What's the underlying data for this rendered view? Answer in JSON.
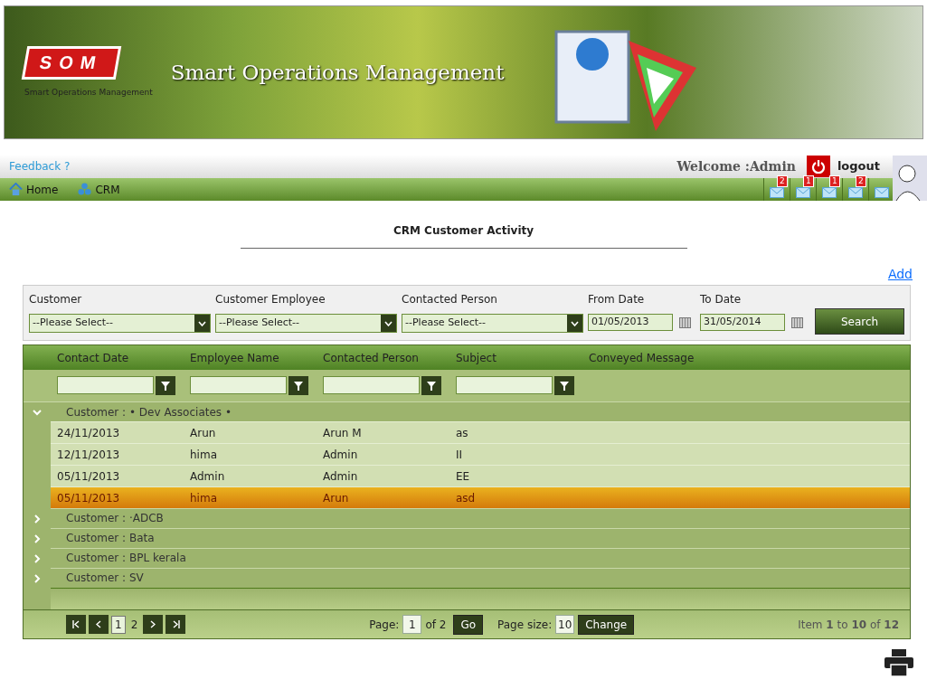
{
  "header": {
    "logo_text": "SOM",
    "logo_caption": "Smart Operations Management",
    "title": "Smart Operations Management"
  },
  "topbar": {
    "feedback": "Feedback",
    "feedback_mark": "?",
    "welcome": "Welcome :Admin",
    "logout": "logout"
  },
  "nav": [
    {
      "label": "Home"
    },
    {
      "label": "CRM"
    }
  ],
  "mail_icons": [
    {
      "kind": "badged",
      "count": "2"
    },
    {
      "kind": "badged",
      "count": "1"
    },
    {
      "kind": "badged",
      "count": "1"
    },
    {
      "kind": "badged",
      "count": "2"
    },
    {
      "kind": "plain"
    }
  ],
  "page_title": "CRM Customer Activity",
  "add_link": "Add",
  "filters": [
    {
      "kind": "select",
      "label": "Customer",
      "value": "--Please Select--"
    },
    {
      "kind": "select",
      "label": "Customer Employee",
      "value": "--Please Select--"
    },
    {
      "kind": "select",
      "label": "Contacted Person",
      "value": "--Please Select--"
    },
    {
      "kind": "date",
      "label": "From Date",
      "value": "01/05/2013"
    },
    {
      "kind": "date",
      "label": "To Date",
      "value": "31/05/2014"
    }
  ],
  "search_button": "Search",
  "grid": {
    "columns": [
      {
        "label": "Contact Date",
        "filter": true
      },
      {
        "label": "Employee Name",
        "filter": true
      },
      {
        "label": "Contacted Person",
        "filter": true
      },
      {
        "label": "Subject",
        "filter": true
      },
      {
        "label": "Conveyed Message",
        "filter": false
      }
    ],
    "groups": [
      {
        "label": "Customer : • Dev Associates •",
        "expanded": true,
        "rows": [
          {
            "cells": [
              "24/11/2013",
              "Arun",
              "Arun M",
              "as"
            ],
            "selected": false
          },
          {
            "cells": [
              "12/11/2013",
              "hima",
              "Admin",
              "II"
            ],
            "selected": false
          },
          {
            "cells": [
              "05/11/2013",
              "Admin",
              "Admin",
              "EE"
            ],
            "selected": false
          },
          {
            "cells": [
              "05/11/2013",
              "hima",
              "Arun",
              "asd"
            ],
            "selected": true
          }
        ]
      },
      {
        "label": "Customer : ·ADCB",
        "expanded": false
      },
      {
        "label": "Customer : Bata",
        "expanded": false
      },
      {
        "label": "Customer : BPL kerala",
        "expanded": false
      },
      {
        "label": "Customer : SV",
        "expanded": false
      }
    ]
  },
  "pager": {
    "pages": [
      {
        "label": "1",
        "selected": true
      },
      {
        "label": "2",
        "selected": false
      }
    ],
    "page_label": "Page:",
    "page_value": "1",
    "of_text": "of 2",
    "go": "Go",
    "size_label": "Page size:",
    "size_value": "10",
    "change": "Change",
    "summary": "Item **1** to **10** of **12**"
  }
}
